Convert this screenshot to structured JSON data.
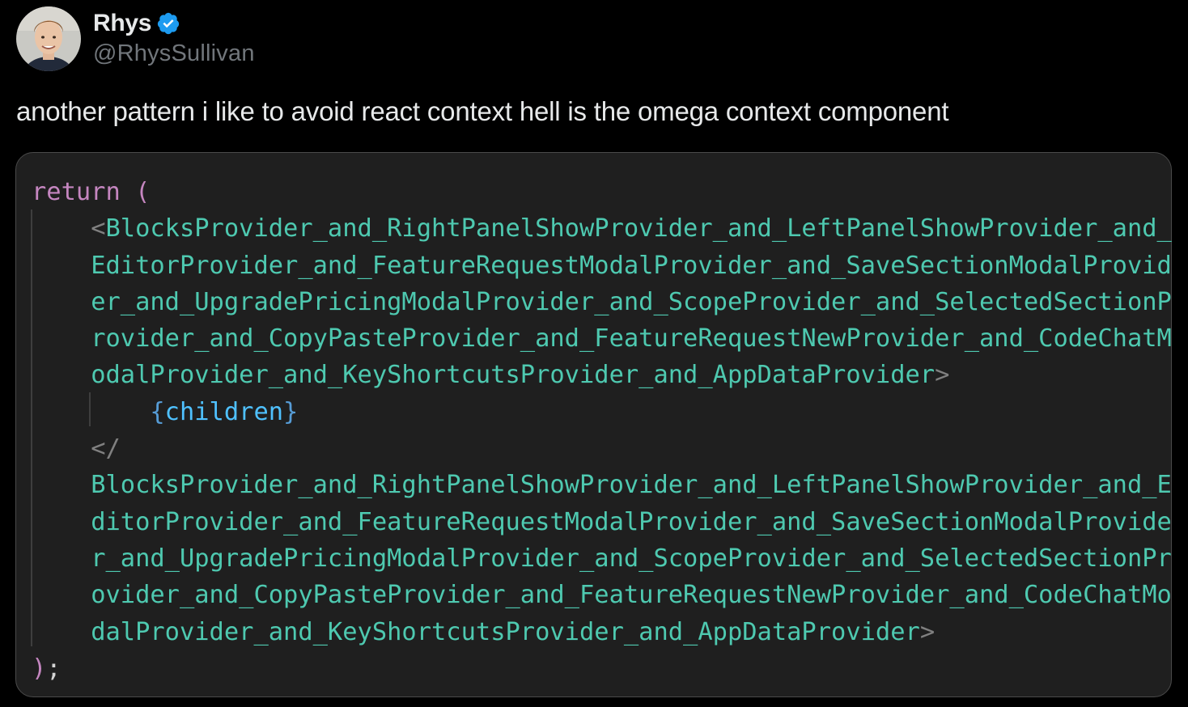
{
  "author": {
    "display_name": "Rhys",
    "handle": "@RhysSullivan",
    "verified": true,
    "verified_color": "#1d9bf0"
  },
  "tweet": {
    "text": "another pattern i like to avoid react context hell is the omega context component"
  },
  "code": {
    "return_kw": "return",
    "open_paren": "(",
    "open_lt": "<",
    "open_tag_lines": [
      "BlocksProvider_and_RightPanelShowProvider_and_LeftPanelShowProvider_and_",
      "EditorProvider_and_FeatureRequestModalProvider_and_SaveSectionModalProvid",
      "er_and_UpgradePricingModalProvider_and_ScopeProvider_and_SelectedSectionP",
      "rovider_and_CopyPasteProvider_and_FeatureRequestNewProvider_and_CodeChatM",
      "odalProvider_and_KeyShortcutsProvider_and_AppDataProvider"
    ],
    "gt": ">",
    "children_open": "{",
    "children_name": "children",
    "children_close": "}",
    "close_lt": "</",
    "close_tag_lines": [
      "BlocksProvider_and_RightPanelShowProvider_and_LeftPanelShowProvider_and_E",
      "ditorProvider_and_FeatureRequestModalProvider_and_SaveSectionModalProvide",
      "r_and_UpgradePricingModalProvider_and_ScopeProvider_and_SelectedSectionPr",
      "ovider_and_CopyPasteProvider_and_FeatureRequestNewProvider_and_CodeChatMo",
      "dalProvider_and_KeyShortcutsProvider_and_AppDataProvider"
    ],
    "close_paren": ")",
    "semicolon": ";",
    "colors": {
      "keyword": "#c586c0",
      "tag": "#4ec9b0",
      "brace": "#569cd6",
      "variable": "#4fc1ff",
      "punctuation": "#808080",
      "background": "#1f1f1f"
    }
  }
}
